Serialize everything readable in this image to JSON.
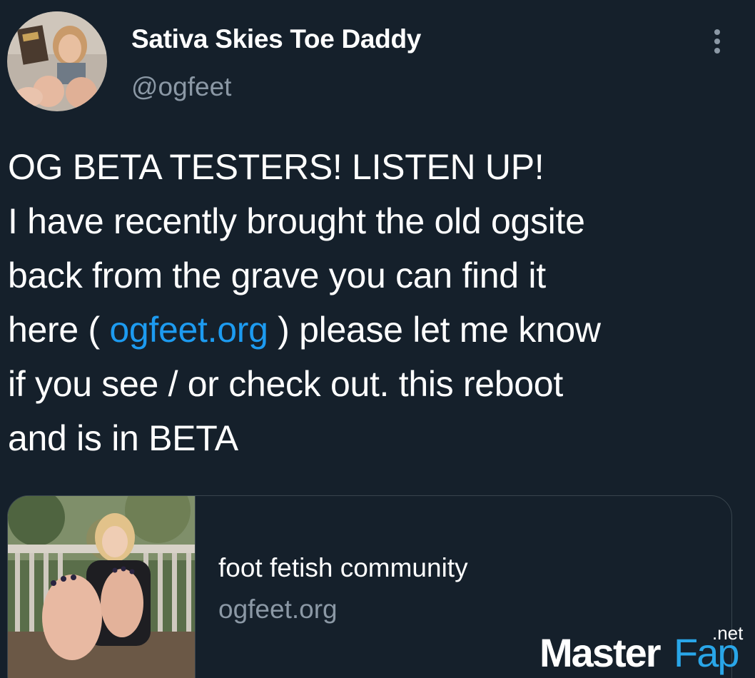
{
  "author": {
    "display_name": "Sativa Skies Toe Daddy",
    "handle": "@ogfeet"
  },
  "icons": {
    "more": "more-vertical-icon",
    "avatar": "profile-photo"
  },
  "tweet": {
    "line1": "OG BETA TESTERS! LISTEN UP!",
    "line2": "I have recently brought the old ogsite",
    "line3": "back from the grave you can find it",
    "line4_pre": "here ( ",
    "line4_link": "ogfeet.org",
    "line4_post": " ) please let me know",
    "line5": "if you see / or check out. this reboot",
    "line6": "and is in BETA"
  },
  "link_card": {
    "title": "foot fetish community",
    "domain": "ogfeet.org"
  },
  "watermark": {
    "word1": "Master",
    "word2": "Fap",
    "suffix": ".net"
  },
  "colors": {
    "background": "#15202b",
    "link": "#1d9bf0",
    "secondary_text": "#8b98a5",
    "border": "#38444d"
  }
}
